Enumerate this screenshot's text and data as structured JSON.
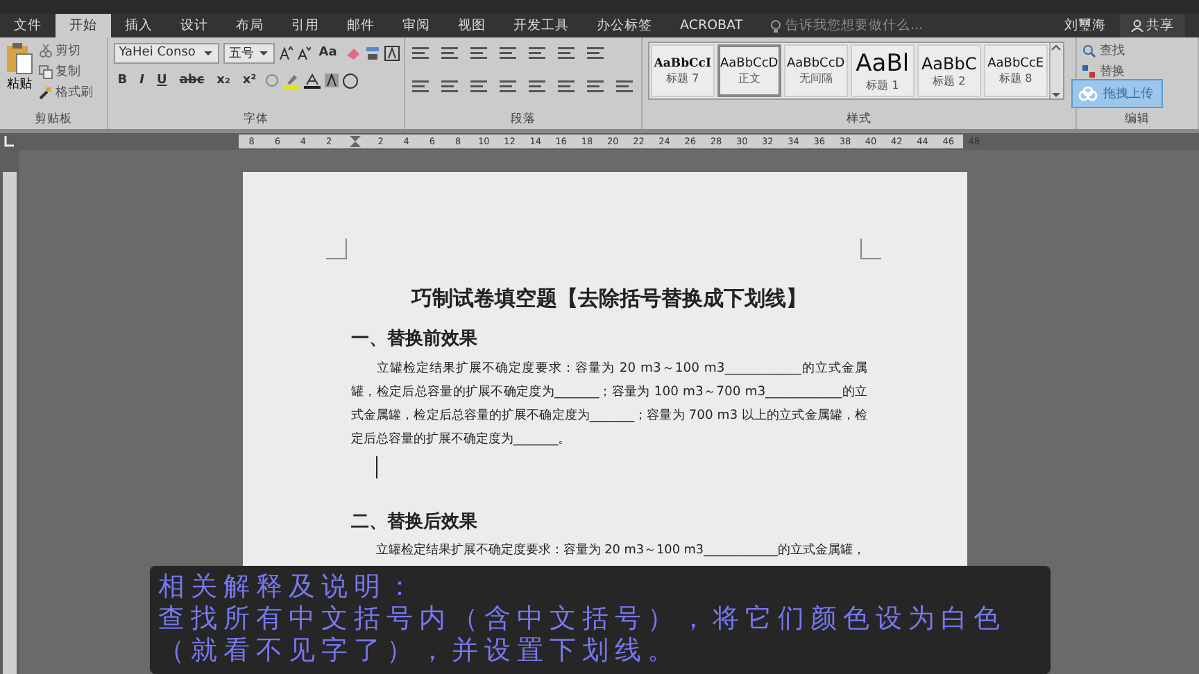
{
  "tabs": [
    {
      "label": "文件",
      "selected": false
    },
    {
      "label": "开始",
      "selected": true
    },
    {
      "label": "插入",
      "selected": false
    },
    {
      "label": "设计",
      "selected": false
    },
    {
      "label": "布局",
      "selected": false
    },
    {
      "label": "引用",
      "selected": false
    },
    {
      "label": "邮件",
      "selected": false
    },
    {
      "label": "审阅",
      "selected": false
    },
    {
      "label": "视图",
      "selected": false
    },
    {
      "label": "开发工具",
      "selected": false
    },
    {
      "label": "办公标签",
      "selected": false
    },
    {
      "label": "ACROBAT",
      "selected": false
    }
  ],
  "tell_me": {
    "placeholder": "告诉我您想要做什么..."
  },
  "user": "刘璽海",
  "share": "共享",
  "ribbon": {
    "clipboard": {
      "paste": "粘贴",
      "cut": "剪切",
      "copy": "复制",
      "format_painter": "格式刷",
      "label": "剪贴板"
    },
    "font": {
      "name": "YaHei Conso",
      "size": "五号",
      "change_case": "Aa",
      "format_buttons": [
        "B",
        "I",
        "U",
        "abc",
        "x₂",
        "x²"
      ],
      "label": "字体"
    },
    "paragraph": {
      "label": "段落"
    },
    "styles": {
      "label": "样式",
      "items": [
        {
          "preview": "AaBbCcI",
          "name": "标题 7",
          "kind": "serif",
          "selected": false
        },
        {
          "preview": "AaBbCcD",
          "name": "正文",
          "kind": "normal",
          "selected": true
        },
        {
          "preview": "AaBbCcD",
          "name": "无间隔",
          "kind": "normal",
          "selected": false
        },
        {
          "preview": "AaBl",
          "name": "标题 1",
          "kind": "large",
          "selected": false
        },
        {
          "preview": "AaBbC",
          "name": "标题 2",
          "kind": "medium",
          "selected": false
        },
        {
          "preview": "AaBbCcE",
          "name": "标题 8",
          "kind": "normal",
          "selected": false
        }
      ]
    },
    "editing": {
      "find": "查找",
      "replace": "替换",
      "label": "编辑"
    }
  },
  "upload_button": "拖拽上传",
  "ruler": {
    "ticks": [
      "8",
      "6",
      "4",
      "2",
      "2",
      "4",
      "6",
      "8",
      "10",
      "12",
      "14",
      "16",
      "18",
      "20",
      "22",
      "24",
      "26",
      "28",
      "30",
      "32",
      "34",
      "36",
      "38",
      "40",
      "42",
      "44",
      "46",
      "48"
    ]
  },
  "document": {
    "title": "巧制试卷填空题【去除括号替换成下划线】",
    "sections": [
      {
        "heading": "一、替换前效果",
        "paragraph": "立罐检定结果扩展不确定度要求：容量为 20 m3～100 m3____________的立式金属罐，检定后总容量的扩展不确定度为_______；容量为 100 m3～700 m3____________的立式金属罐，检定后总容量的扩展不确定度为_______；容量为 700 m3 以上的立式金属罐，检定后总容量的扩展不确定度为_______。"
      },
      {
        "heading": "二、替换后效果",
        "paragraph": "立罐检定结果扩展不确定度要求：容量为 20 m3～100 m3____________的立式金属罐，"
      }
    ]
  },
  "caption": [
    "相关解释及说明：",
    "查找所有中文括号内（含中文括号），将它们颜色设为白色",
    "（就看不见字了），并设置下划线。"
  ]
}
